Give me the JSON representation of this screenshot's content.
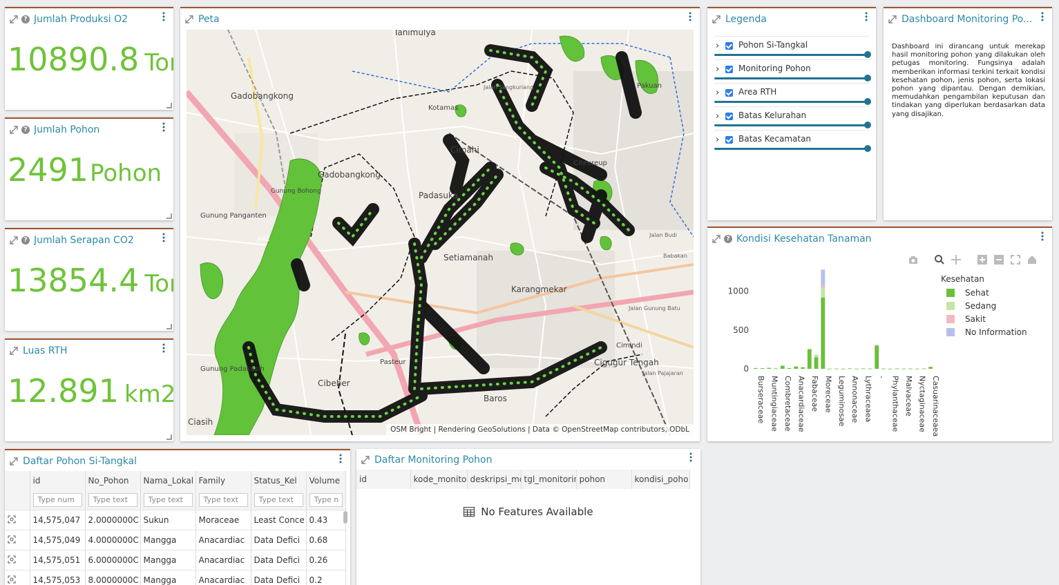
{
  "counters": [
    {
      "title": "Jumlah Produksi O2",
      "value": "10890.8",
      "unit": "Ton",
      "help": true
    },
    {
      "title": "Jumlah Pohon",
      "value": "2491",
      "unit": "Pohon",
      "help": true
    },
    {
      "title": "Jumlah Serapan CO2",
      "value": "13854.4",
      "unit": "Ton",
      "help": true
    },
    {
      "title": "Luas RTH",
      "value": "12.891",
      "unit": "km2",
      "help": false
    }
  ],
  "map": {
    "title": "Peta",
    "place_labels": [
      "Tanimulya",
      "Gadobangkong",
      "Gadobangkong",
      "Gunung Bohong",
      "Gunung Panganten",
      "AH2",
      "Padasuka",
      "Cimahi",
      "Setiamanah",
      "Karangmekar",
      "Cibeber",
      "Pasteur",
      "Baros",
      "Cigugur Tengah",
      "Gunung Padakasih",
      "Ciasih",
      "Cimindi",
      "Kotamas",
      "Citeureup",
      "Jalan Sangkuriang",
      "Jalan Gunung Batu",
      "Jalan Pajajaran",
      "Pakuan",
      "Jalan Budi",
      "Babakan"
    ],
    "attribution": "OSM Bright | Rendering GeoSolutions | Data © OpenStreetMap contributors, ODbL"
  },
  "legend": {
    "title": "Legenda",
    "items": [
      "Pohon Si-Tangkal",
      "Monitoring Pohon",
      "Area RTH",
      "Batas Kelurahan",
      "Batas Kecamatan"
    ]
  },
  "about": {
    "title": "Dashboard Monitoring Po...",
    "text": "Dashboard ini dirancang untuk merekap hasil monitoring pohon yang dilakukan oleh petugas monitoring. Fungsinya adalah memberikan informasi terkini terkait kondisi kesehatan pohon, jenis pohon, serta lokasi pohon yang dipantau. Dengan demikian, memudahkan pengambilan keputusan dan tindakan yang diperlukan berdasarkan data yang disajikan."
  },
  "chart_panel": {
    "title": "Kondisi Kesehatan Tanaman"
  },
  "chart_data": {
    "type": "bar",
    "stacked": true,
    "categories": [
      "Burseraceae",
      "",
      "Muntingiaceae",
      "",
      "Combretaceae",
      "",
      "Anacardiaceae",
      "",
      "Fabaceae",
      "",
      "Moreceae",
      "",
      "Leguminosae",
      "",
      "Annonaceae",
      "",
      "Lythraceaea",
      "",
      "-",
      "",
      "Phylanthaceae",
      "",
      "Malvaceae",
      "",
      "Nyctaginaceae",
      "",
      "Casuarinaceaea"
    ],
    "series": [
      {
        "name": "Sehat",
        "color": "#6bbf3b",
        "values": [
          10,
          8,
          12,
          5,
          40,
          10,
          30,
          20,
          250,
          150,
          920,
          2,
          3,
          2,
          6,
          2,
          5,
          3,
          300,
          3,
          2,
          4,
          3,
          3,
          2,
          4,
          25
        ]
      },
      {
        "name": "Sedang",
        "color": "#c5e4a5",
        "values": [
          0,
          0,
          0,
          0,
          0,
          0,
          0,
          0,
          10,
          20,
          120,
          0,
          0,
          0,
          0,
          0,
          0,
          0,
          10,
          0,
          0,
          0,
          0,
          0,
          0,
          0,
          0
        ]
      },
      {
        "name": "Sakit",
        "color": "#f2bac0",
        "values": [
          0,
          0,
          0,
          0,
          0,
          0,
          0,
          0,
          0,
          0,
          30,
          0,
          0,
          0,
          0,
          0,
          0,
          0,
          0,
          0,
          0,
          0,
          0,
          0,
          0,
          0,
          0
        ]
      },
      {
        "name": "No Information",
        "color": "#b8bff0",
        "values": [
          0,
          0,
          0,
          0,
          0,
          0,
          0,
          0,
          0,
          10,
          210,
          0,
          0,
          0,
          0,
          0,
          0,
          0,
          0,
          0,
          0,
          0,
          0,
          0,
          0,
          0,
          0
        ]
      }
    ],
    "yticks": [
      0,
      500,
      1000
    ],
    "ylim": [
      0,
      1300
    ],
    "legend_title": "Kesehatan",
    "legend_position": "right"
  },
  "table1": {
    "title": "Daftar Pohon Si-Tangkal",
    "columns": [
      "id",
      "No_Pohon",
      "Nama_Lokal",
      "Family",
      "Status_Kel",
      "Volume"
    ],
    "filters": [
      "Type num",
      "Type text",
      "Type text",
      "Type text",
      "Type text",
      "Type n"
    ],
    "rows": [
      [
        "14,575,047",
        "2.0000000C",
        "Sukun",
        "Moraceae",
        "Least Conce",
        "0.43"
      ],
      [
        "14,575,049",
        "4.0000000C",
        "Mangga",
        "Anacardiac",
        "Data Defici",
        "0.68"
      ],
      [
        "14,575,051",
        "6.0000000C",
        "Mangga",
        "Anacardiac",
        "Data Defici",
        "0.26"
      ],
      [
        "14,575,053",
        "8.0000000C",
        "Mangga",
        "Anacardiac",
        "Data Defici",
        "0.2"
      ]
    ]
  },
  "table2": {
    "title": "Daftar Monitoring Pohon",
    "columns": [
      "id",
      "kode_monitor",
      "deskripsi_mo",
      "tgl_monitorin",
      "pohon",
      "kondisi_poho"
    ],
    "empty": "No Features Available"
  }
}
